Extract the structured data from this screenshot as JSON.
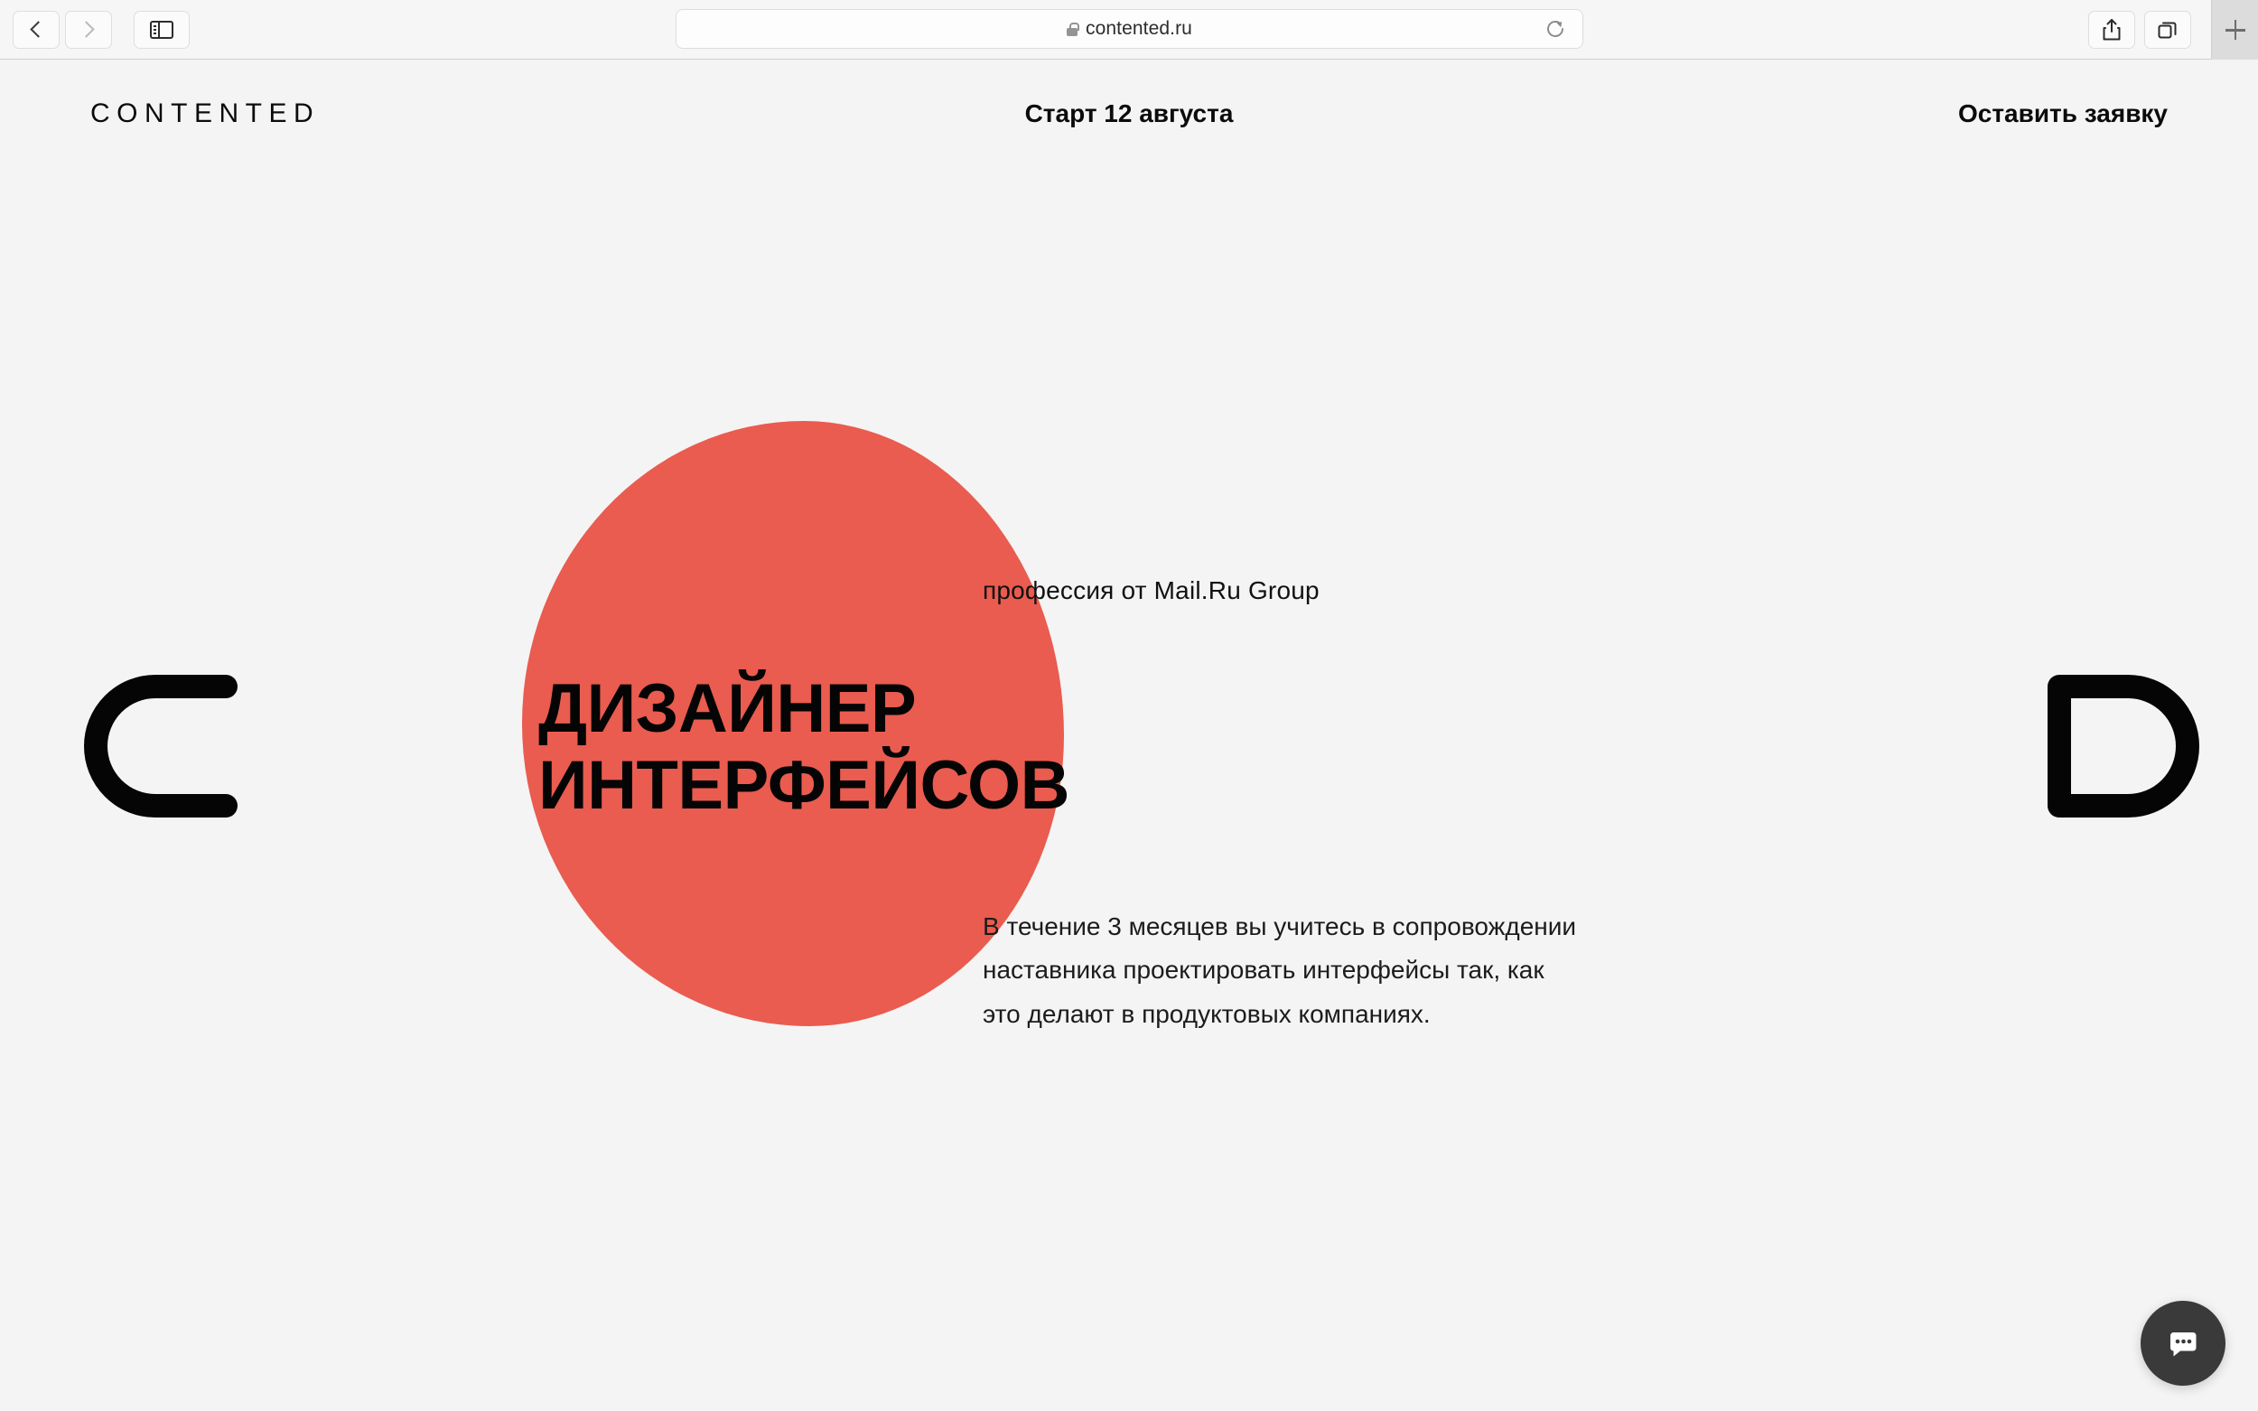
{
  "browser": {
    "back_label": "Back",
    "forward_label": "Forward",
    "sidebar_label": "Sidebar",
    "url": "contented.ru",
    "reload_label": "Reload",
    "share_label": "Share",
    "tabs_overview_label": "Tab Overview",
    "new_tab_label": "+",
    "secure_icon": "lock-icon"
  },
  "header": {
    "logo": "CONTENTED",
    "start_date": "Старт 12 августа",
    "cta": "Оставить заявку"
  },
  "hero": {
    "eyebrow": "профессия от Mail.Ru Group",
    "title": "ДИЗАЙНЕР\nИНТЕРФЕЙСОВ",
    "description": "В течение 3 месяцев вы учитесь в сопровождении\nнаставника проектировать интерфейсы так, как\nэто делают в продуктовых компаниях.",
    "decoration_left_letter": "C",
    "decoration_right_letter": "D"
  },
  "chat": {
    "label": "Chat",
    "icon": "chat-bubble-icon"
  },
  "colors": {
    "accent_red": "#e95c4f",
    "page_background": "#f4f4f4",
    "text": "#0b0b0b",
    "chat_button": "#3a3a3a"
  }
}
